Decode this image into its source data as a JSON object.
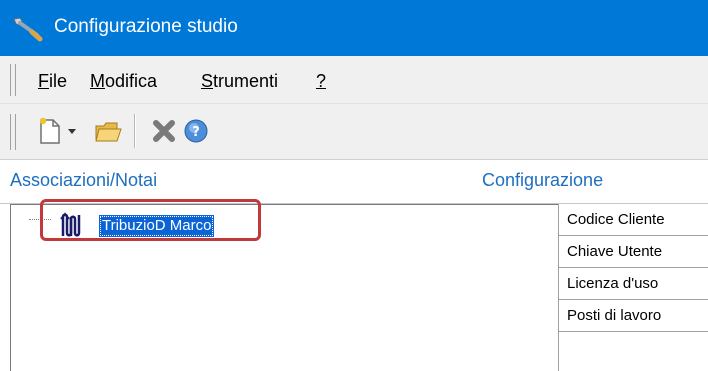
{
  "window": {
    "title": "Configurazione studio",
    "icon": "wrench-icon",
    "accent_color": "#0078d7"
  },
  "menubar": {
    "items": [
      {
        "label_underlined": "F",
        "label_rest": "ile"
      },
      {
        "label_underlined": "M",
        "label_rest": "odifica"
      },
      {
        "label_underlined": "S",
        "label_rest": "trumenti"
      },
      {
        "label_underlined": "?",
        "label_rest": ""
      }
    ]
  },
  "toolbar": {
    "buttons": [
      "new-document-icon",
      "dropdown-arrow-icon",
      "open-folder-icon",
      "delete-icon",
      "help-icon"
    ]
  },
  "panels": {
    "left_header": "Associazioni/Notai",
    "right_header": "Configurazione"
  },
  "tree": {
    "nodes": [
      {
        "label": "TribuzioD Marco",
        "icon": "notary-icon",
        "selected": true
      }
    ]
  },
  "config": {
    "rows": [
      "Codice Cliente",
      "Chiave Utente",
      "Licenza d'uso",
      "Posti di lavoro"
    ]
  },
  "highlight_color": "#c0393b"
}
